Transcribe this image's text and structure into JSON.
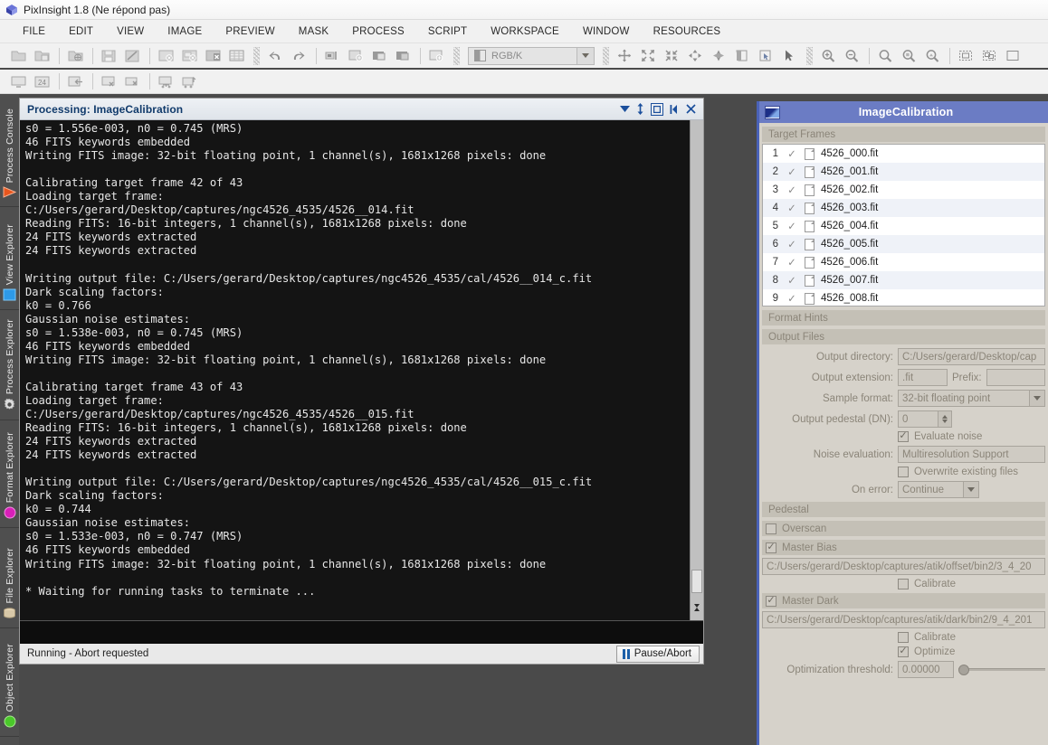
{
  "window": {
    "app_title": "PixInsight 1.8 (Ne répond pas)",
    "logo_icon": "pixinsight-cube-icon"
  },
  "menubar": {
    "items": [
      {
        "label": "FILE"
      },
      {
        "label": "EDIT"
      },
      {
        "label": "VIEW"
      },
      {
        "label": "IMAGE"
      },
      {
        "label": "PREVIEW"
      },
      {
        "label": "MASK"
      },
      {
        "label": "PROCESS"
      },
      {
        "label": "SCRIPT"
      },
      {
        "label": "WORKSPACE"
      },
      {
        "label": "WINDOW"
      },
      {
        "label": "RESOURCES"
      }
    ]
  },
  "toolbar": {
    "color_space_value": "RGB/K",
    "row1_icons": [
      "open-folder-icon",
      "open-folder-copy-icon",
      "open-url-icon",
      "save-icon",
      "save-as-icon",
      "close-window-icon",
      "close-all-icon",
      "close-other-icon",
      "file-table-icon",
      "undo-icon",
      "redo-icon",
      "window-fit-icon",
      "duplicate-window-icon",
      "mask-show-icon",
      "mask-invert-icon",
      "new-preview-icon"
    ],
    "row1_right_icons": [
      "move-mode-icon",
      "expand-all-icon",
      "collapse-all-icon",
      "fit-window-icon",
      "pan-mode-icon",
      "mask-panel-icon",
      "mask-select-icon",
      "pointer-icon",
      "zoom-in-icon",
      "zoom-out-icon",
      "zoom-fit-icon",
      "zoom-1-1-icon",
      "zoom-actual-icon",
      "select-preview-icon",
      "select-previews-icon",
      "new-preview-region-icon"
    ],
    "row2_icons": [
      "screen-transfer-icon",
      "24bit-icon",
      "import-window-icon",
      "screen-close-icon",
      "screen-close-all-icon",
      "network-down-icon",
      "network-up-icon"
    ]
  },
  "sidebar": {
    "tabs": [
      {
        "label": "Process Console",
        "icon": "orange-triangle-icon"
      },
      {
        "label": "View Explorer",
        "icon": "blue-square-icon"
      },
      {
        "label": "Process Explorer",
        "icon": "gear-icon"
      },
      {
        "label": "Format Explorer",
        "icon": "magenta-circle-icon"
      },
      {
        "label": "File Explorer",
        "icon": "cylinder-icon"
      },
      {
        "label": "Object Explorer",
        "icon": "green-sphere-icon"
      }
    ]
  },
  "console": {
    "title": "Processing: ImageCalibration",
    "controls": [
      {
        "icon": "chevron-down-icon"
      },
      {
        "icon": "resize-vertical-icon"
      },
      {
        "icon": "maximize-icon"
      },
      {
        "icon": "dock-left-icon"
      },
      {
        "icon": "close-icon"
      }
    ],
    "log": "s0 = 1.556e-003, n0 = 0.745 (MRS)\n46 FITS keywords embedded\nWriting FITS image: 32-bit floating point, 1 channel(s), 1681x1268 pixels: done\n\nCalibrating target frame 42 of 43\nLoading target frame:\nC:/Users/gerard/Desktop/captures/ngc4526_4535/4526__014.fit\nReading FITS: 16-bit integers, 1 channel(s), 1681x1268 pixels: done\n24 FITS keywords extracted\n24 FITS keywords extracted\n\nWriting output file: C:/Users/gerard/Desktop/captures/ngc4526_4535/cal/4526__014_c.fit\nDark scaling factors:\nk0 = 0.766\nGaussian noise estimates:\ns0 = 1.538e-003, n0 = 0.745 (MRS)\n46 FITS keywords embedded\nWriting FITS image: 32-bit floating point, 1 channel(s), 1681x1268 pixels: done\n\nCalibrating target frame 43 of 43\nLoading target frame:\nC:/Users/gerard/Desktop/captures/ngc4526_4535/4526__015.fit\nReading FITS: 16-bit integers, 1 channel(s), 1681x1268 pixels: done\n24 FITS keywords extracted\n24 FITS keywords extracted\n\nWriting output file: C:/Users/gerard/Desktop/captures/ngc4526_4535/cal/4526__015_c.fit\nDark scaling factors:\nk0 = 0.744\nGaussian noise estimates:\ns0 = 1.533e-003, n0 = 0.747 (MRS)\n46 FITS keywords embedded\nWriting FITS image: 32-bit floating point, 1 channel(s), 1681x1268 pixels: done\n\n* Waiting for running tasks to terminate ...",
    "status_text": "Running - Abort requested",
    "pause_button_label": "Pause/Abort"
  },
  "calibration": {
    "title": "ImageCalibration",
    "sections": {
      "target_frames": "Target Frames",
      "format_hints": "Format Hints",
      "output_files": "Output Files",
      "pedestal": "Pedestal",
      "overscan": "Overscan",
      "master_bias": "Master Bias",
      "master_dark": "Master Dark"
    },
    "files": [
      {
        "num": "1",
        "name": "4526_000.fit",
        "checked": true
      },
      {
        "num": "2",
        "name": "4526_001.fit",
        "checked": true
      },
      {
        "num": "3",
        "name": "4526_002.fit",
        "checked": true
      },
      {
        "num": "4",
        "name": "4526_003.fit",
        "checked": true
      },
      {
        "num": "5",
        "name": "4526_004.fit",
        "checked": true
      },
      {
        "num": "6",
        "name": "4526_005.fit",
        "checked": true
      },
      {
        "num": "7",
        "name": "4526_006.fit",
        "checked": true
      },
      {
        "num": "8",
        "name": "4526_007.fit",
        "checked": true
      },
      {
        "num": "9",
        "name": "4526_008.fit",
        "checked": true
      }
    ],
    "output": {
      "directory_label": "Output directory:",
      "directory_value": "C:/Users/gerard/Desktop/cap",
      "extension_label": "Output extension:",
      "extension_value": ".fit",
      "prefix_label": "Prefix:",
      "prefix_value": "",
      "sample_format_label": "Sample format:",
      "sample_format_value": "32-bit floating point",
      "pedestal_dn_label": "Output pedestal (DN):",
      "pedestal_dn_value": "0",
      "evaluate_noise_label": "Evaluate noise",
      "evaluate_noise_checked": true,
      "noise_eval_label": "Noise evaluation:",
      "noise_eval_value": "Multiresolution Support",
      "overwrite_label": "Overwrite existing files",
      "overwrite_checked": false,
      "on_error_label": "On error:",
      "on_error_value": "Continue"
    },
    "overscan": {
      "label": "Overscan",
      "checked": false
    },
    "master_bias": {
      "label": "Master Bias",
      "checked": true,
      "path": "C:/Users/gerard/Desktop/captures/atik/offset/bin2/3_4_20",
      "calibrate_label": "Calibrate",
      "calibrate_checked": false
    },
    "master_dark": {
      "label": "Master Dark",
      "checked": true,
      "path": "C:/Users/gerard/Desktop/captures/atik/dark/bin2/9_4_201",
      "calibrate_label": "Calibrate",
      "calibrate_checked": false,
      "optimize_label": "Optimize",
      "optimize_checked": true,
      "threshold_label": "Optimization threshold:",
      "threshold_value": "0.00000"
    }
  },
  "colors": {
    "panel_accent": "#4a62b8",
    "title_bar": "#6b7cc4",
    "console_bg": "#141414",
    "console_title_text": "#103a6b",
    "pause_accent": "#1c5fa8"
  }
}
